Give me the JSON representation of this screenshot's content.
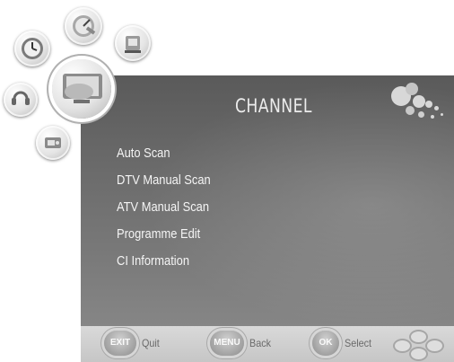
{
  "screen": {
    "title": "CHANNEL",
    "menu_items": [
      {
        "label": "Auto Scan"
      },
      {
        "label": "DTV Manual Scan"
      },
      {
        "label": "ATV Manual Scan"
      },
      {
        "label": "Programme Edit"
      },
      {
        "label": "CI Information"
      }
    ]
  },
  "footer": {
    "exit": {
      "key": "EXIT",
      "label": "Quit"
    },
    "menu": {
      "key": "MENU",
      "label": "Back"
    },
    "ok": {
      "key": "OK",
      "label": "Select"
    }
  },
  "side_menu": {
    "icons": [
      {
        "name": "clock-icon"
      },
      {
        "name": "gauge-icon"
      },
      {
        "name": "lock-icon"
      },
      {
        "name": "tv-channel-icon",
        "active": true
      },
      {
        "name": "sound-icon"
      },
      {
        "name": "settings-icon"
      }
    ]
  }
}
